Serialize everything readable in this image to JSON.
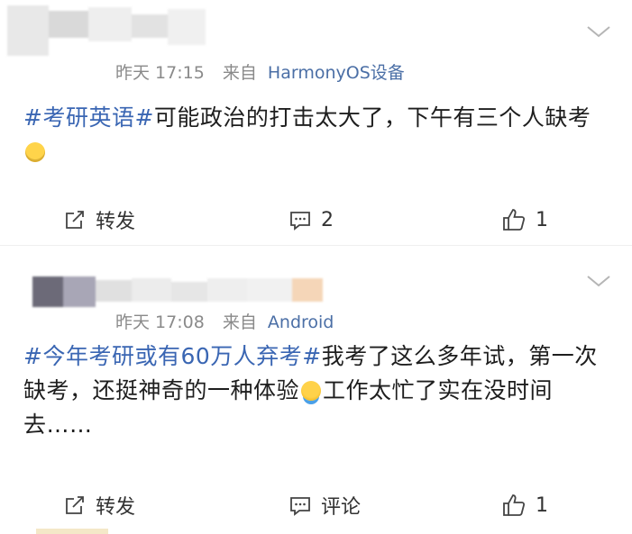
{
  "colors": {
    "topic": "#3a66b3",
    "device": "#4b6fa6",
    "meta": "#8a8a8a",
    "text": "#1e1e1e"
  },
  "posts": [
    {
      "time": "昨天 17:15",
      "source_prefix": "来自",
      "device": "HarmonyOS设备",
      "topic": "#考研英语#",
      "text": "可能政治的打击太大了，下午有三个人缺考",
      "emoji": "laughing-crying-emoji",
      "actions": {
        "repost_label": "转发",
        "comment_label": "2",
        "like_label": "1"
      }
    },
    {
      "time": "昨天 17:08",
      "source_prefix": "来自",
      "device": "Android",
      "topic": "#今年考研或有60万人弃考#",
      "text_before_emoji": "我考了这么多年试，第一次缺考，还挺神奇的一种体验",
      "emoji": "shrug-emoji",
      "text_after_emoji": "工作太忙了实在没时间去……",
      "actions": {
        "repost_label": "转发",
        "comment_label": "评论",
        "like_label": "1"
      }
    }
  ]
}
